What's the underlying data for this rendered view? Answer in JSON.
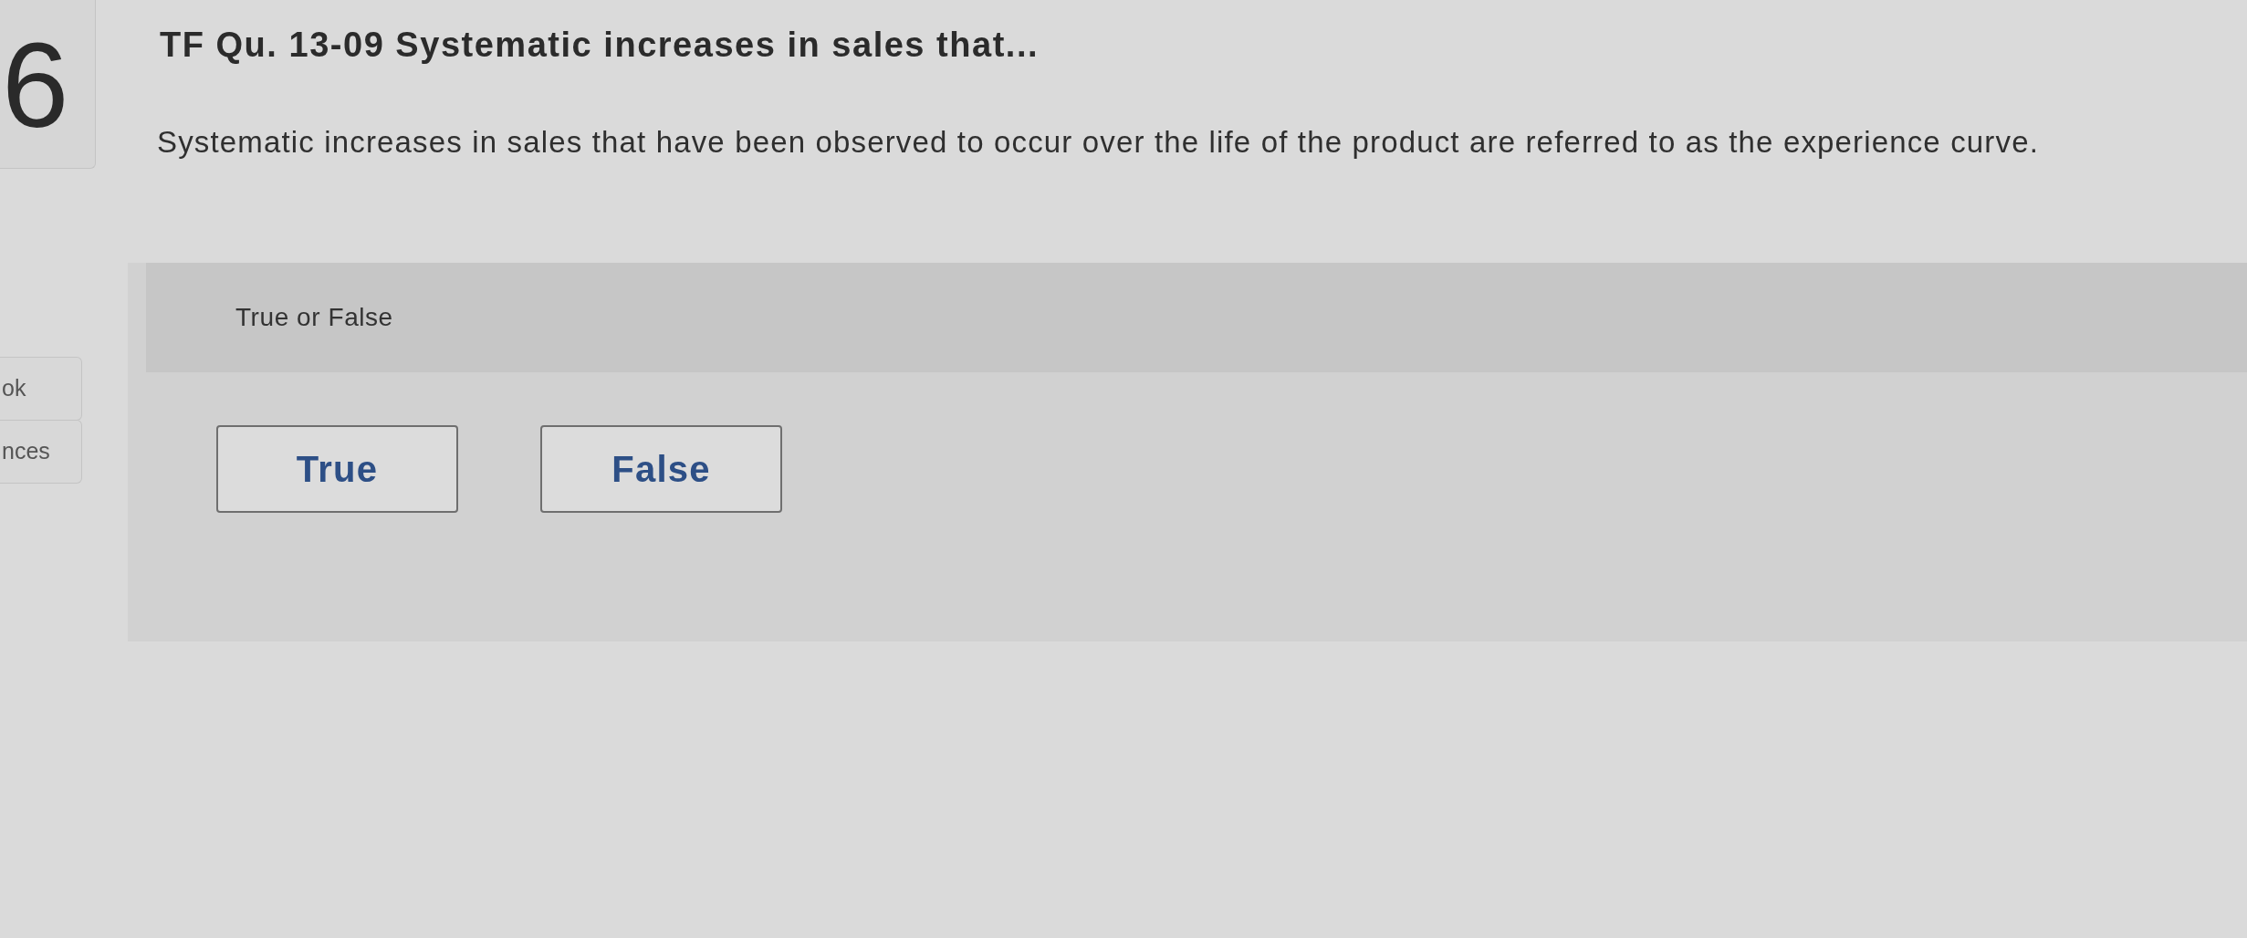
{
  "question_number": "6",
  "sidebar": {
    "items": [
      {
        "label": "ok"
      },
      {
        "label": "nces"
      }
    ]
  },
  "question": {
    "title": "TF Qu. 13-09 Systematic increases in sales that...",
    "text": "Systematic increases in sales that have been observed to occur over the life of the product are referred to as the experience curve.",
    "prompt": "True or False",
    "options": [
      {
        "label": "True",
        "selected": false
      },
      {
        "label": "False",
        "selected": false
      }
    ]
  }
}
